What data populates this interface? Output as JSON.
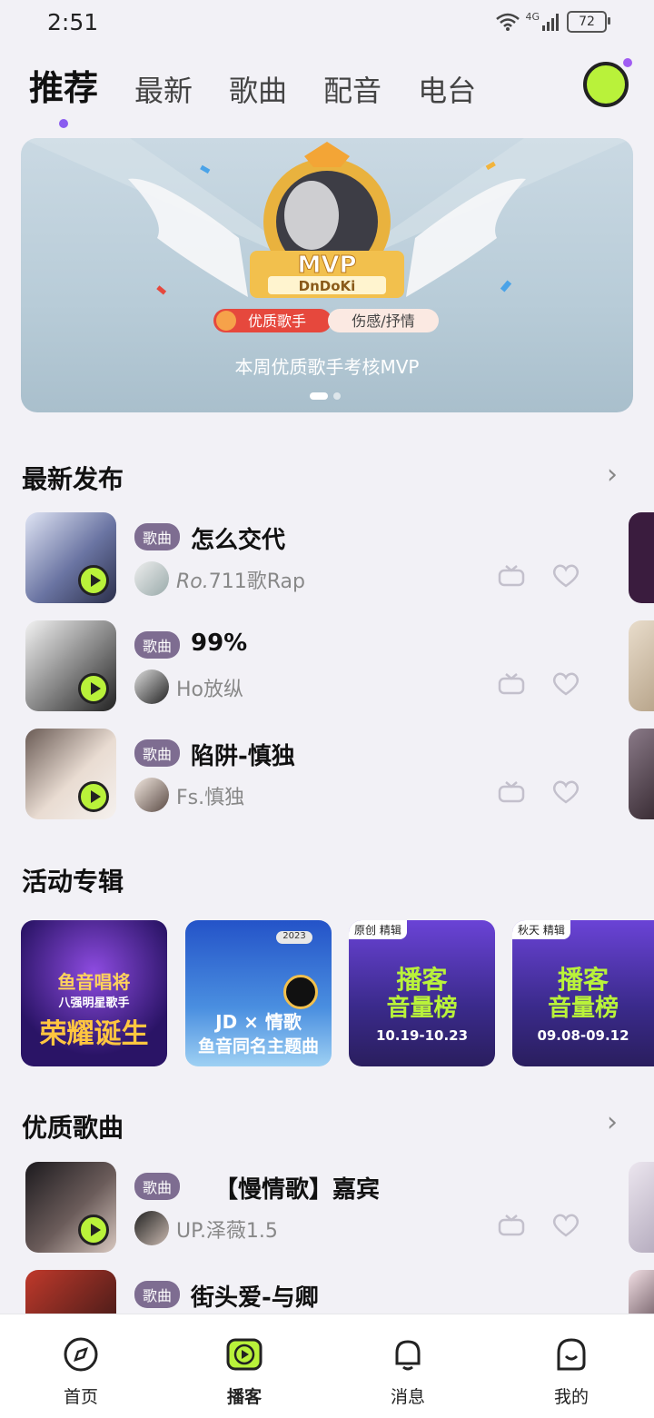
{
  "status": {
    "time": "2:51",
    "network": "4G",
    "battery": "72"
  },
  "tabs": [
    {
      "label": "推荐",
      "active": true
    },
    {
      "label": "最新"
    },
    {
      "label": "歌曲"
    },
    {
      "label": "配音"
    },
    {
      "label": "电台"
    }
  ],
  "banner": {
    "badge_title": "MVP",
    "name": "DnDoKi",
    "tag_left": "优质歌手",
    "tag_right": "伤感/抒情",
    "caption": "本周优质歌手考核MVP",
    "pages": 2,
    "current_page": 1
  },
  "latest": {
    "title": "最新发布",
    "items": [
      {
        "tag": "歌曲",
        "title": "怎么交代",
        "artist_prefix": "Ro.",
        "artist": "711歌Rap"
      },
      {
        "tag": "歌曲",
        "title": "99%",
        "artist": "Ho放纵"
      },
      {
        "tag": "歌曲",
        "title": "陷阱-慎独",
        "artist": "Fs.慎独"
      }
    ]
  },
  "albums": {
    "title": "活动专辑",
    "items": [
      {
        "line1": "鱼音唱将",
        "line2": "八强明星歌手",
        "line3": "荣耀诞生"
      },
      {
        "line1": "JD × 情歌",
        "line2": "鱼音同名主题曲",
        "year": "2023"
      },
      {
        "corner": "原创 精辑",
        "line1": "播客",
        "line2": "音量榜",
        "dates": "10.19-10.23"
      },
      {
        "corner": "秋天 精辑",
        "line1": "播客",
        "line2": "音量榜",
        "dates": "09.08-09.12"
      }
    ]
  },
  "quality": {
    "title": "优质歌曲",
    "items": [
      {
        "tag": "歌曲",
        "title": "【慢情歌】嘉宾",
        "artist": "UP.泽薇1.5"
      },
      {
        "tag": "歌曲",
        "title": "街头爱-与卿"
      }
    ]
  },
  "nav": [
    {
      "label": "首页"
    },
    {
      "label": "播客",
      "active": true
    },
    {
      "label": "消息"
    },
    {
      "label": "我的"
    }
  ],
  "colors": {
    "accent_green": "#b9f23a",
    "accent_purple": "#8a5cf0",
    "tag_bg": "#7e6d91"
  }
}
